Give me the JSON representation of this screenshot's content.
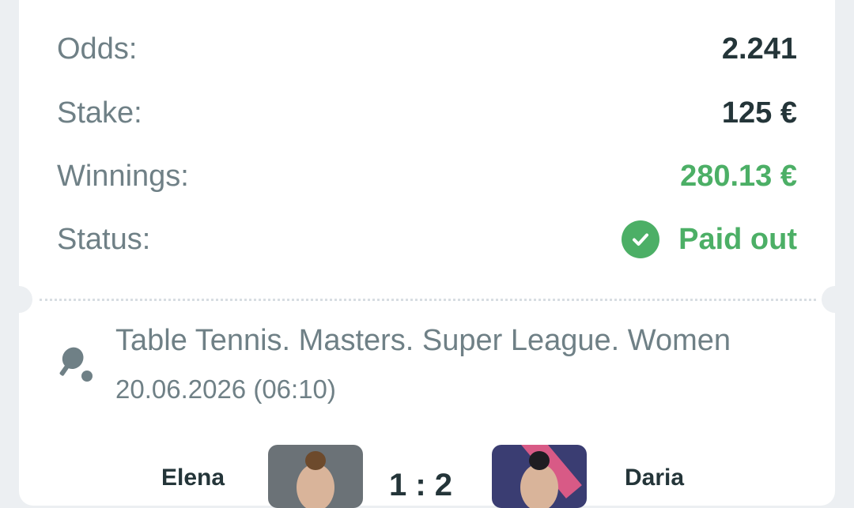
{
  "bet_summary": {
    "odds": {
      "label": "Odds:",
      "value": "2.241"
    },
    "stake": {
      "label": "Stake:",
      "value": "125 €"
    },
    "winnings": {
      "label": "Winnings:",
      "value": "280.13 €"
    },
    "status": {
      "label": "Status:",
      "value": "Paid out",
      "icon": "check-circle-icon"
    }
  },
  "event": {
    "sport_icon": "table-tennis-icon",
    "title": "Table Tennis. Masters. Super League. Women",
    "datetime": "20.06.2026 (06:10)"
  },
  "match": {
    "home_name": "Elena",
    "away_name": "Daria",
    "score": "1 : 2"
  },
  "colors": {
    "page_background": "#eceff2",
    "card": "#ffffff",
    "label": "#6f8086",
    "value": "#243539",
    "accent_green": "#4caf66"
  }
}
